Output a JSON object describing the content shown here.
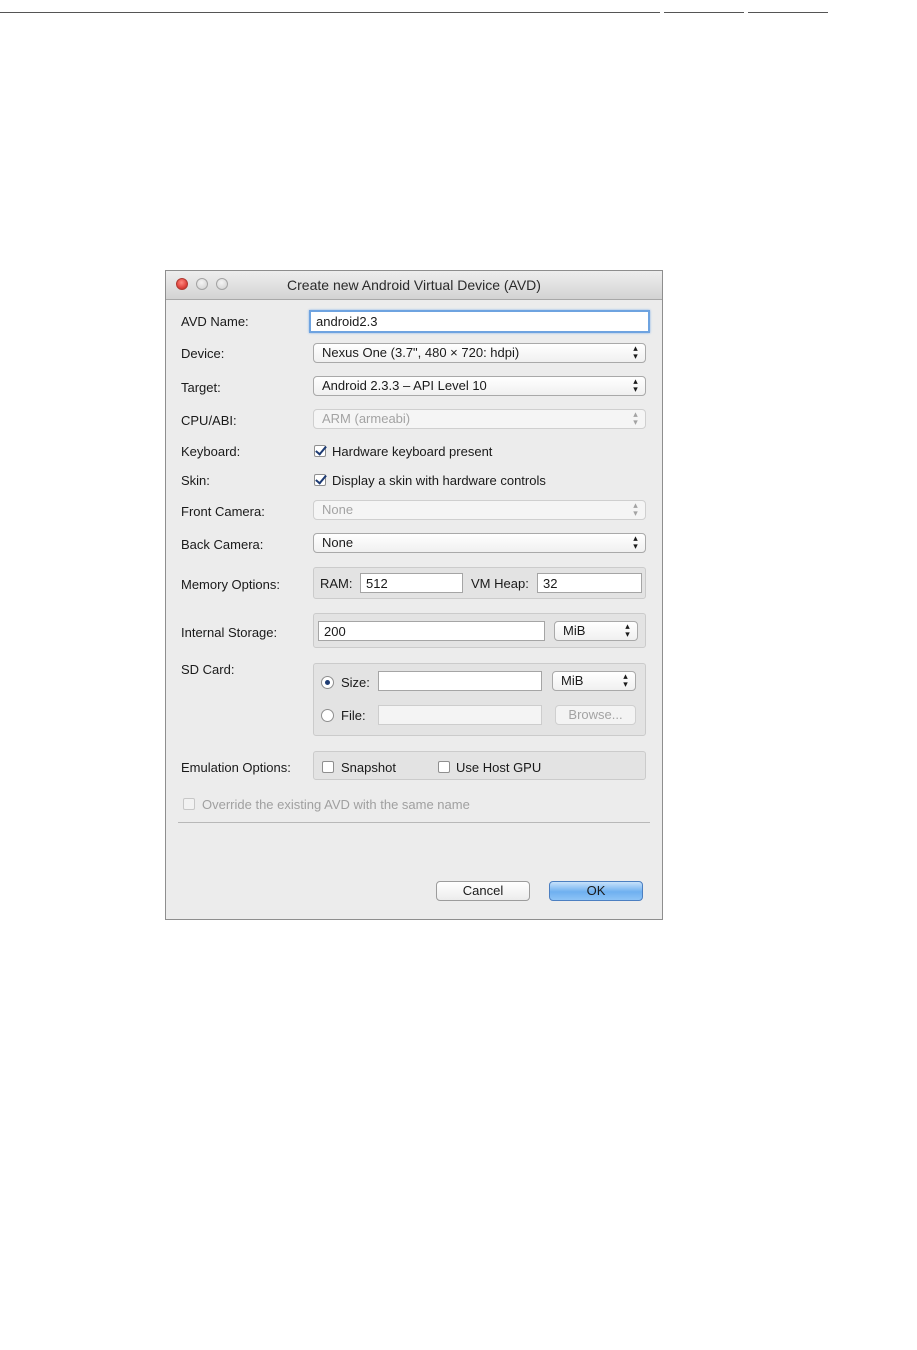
{
  "window": {
    "title": "Create new Android Virtual Device (AVD)"
  },
  "avd_name": {
    "label": "AVD Name:",
    "value": "android2.3"
  },
  "device": {
    "label": "Device:",
    "value": "Nexus One (3.7\", 480 × 720: hdpi)"
  },
  "target": {
    "label": "Target:",
    "value": "Android 2.3.3 – API Level 10"
  },
  "cpu": {
    "label": "CPU/ABI:",
    "value": "ARM (armeabi)"
  },
  "keyboard": {
    "label": "Keyboard:",
    "checkbox_label": "Hardware keyboard present",
    "checked": true
  },
  "skin": {
    "label": "Skin:",
    "checkbox_label": "Display a skin with hardware controls",
    "checked": true
  },
  "front_camera": {
    "label": "Front Camera:",
    "value": "None"
  },
  "back_camera": {
    "label": "Back Camera:",
    "value": "None"
  },
  "memory": {
    "label": "Memory Options:",
    "ram_label": "RAM:",
    "ram_value": "512",
    "vm_heap_label": "VM Heap:",
    "vm_heap_value": "32"
  },
  "internal_storage": {
    "label": "Internal Storage:",
    "value": "200",
    "unit": "MiB"
  },
  "sd_card": {
    "label": "SD Card:",
    "size_label": "Size:",
    "size_value": "",
    "size_unit": "MiB",
    "file_label": "File:",
    "file_value": "",
    "browse_label": "Browse...",
    "selected": "size"
  },
  "emulation": {
    "label": "Emulation Options:",
    "snapshot_label": "Snapshot",
    "host_gpu_label": "Use Host GPU"
  },
  "override": {
    "label": "Override the existing AVD with the same name"
  },
  "buttons": {
    "cancel": "Cancel",
    "ok": "OK"
  },
  "colors": {
    "focus_ring": "#6ea3e0",
    "default_button": "#6fb0f0",
    "close_button": "#e0443e"
  }
}
